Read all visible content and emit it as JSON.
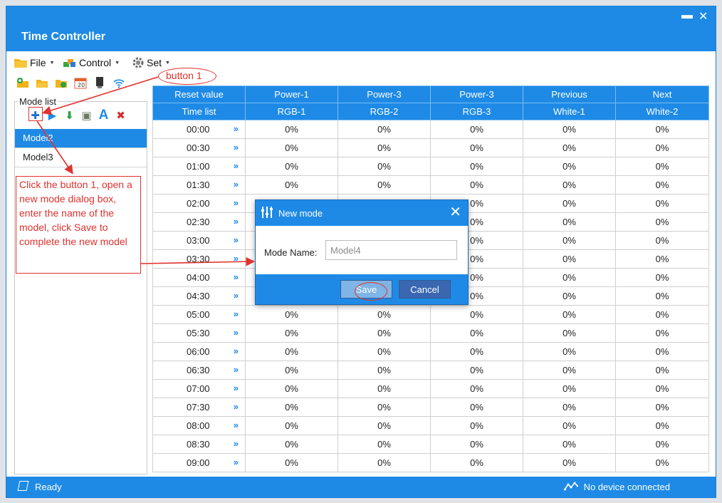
{
  "window": {
    "title": "Time Controller",
    "minimize_glyph": "▬",
    "close_glyph": "✕"
  },
  "menu": [
    {
      "label": "File",
      "icon": "folder-icon"
    },
    {
      "label": "Control",
      "icon": "blocks-icon"
    },
    {
      "label": "Set",
      "icon": "gear-icon"
    }
  ],
  "toolbar_icons": [
    "add-folder-icon",
    "open-folder-icon",
    "save-folder-icon",
    "calendar-icon",
    "device-icon",
    "wifi-icon"
  ],
  "mode_list": {
    "label": "Mode list",
    "tools": [
      {
        "name": "add-mode-icon",
        "glyph": "✚",
        "color": "#1e6fd0"
      },
      {
        "name": "play-icon",
        "glyph": "▶",
        "color": "#1e8ae6"
      },
      {
        "name": "download-icon",
        "glyph": "⬇",
        "color": "#2ea043"
      },
      {
        "name": "device-save-icon",
        "glyph": "▣",
        "color": "#6b7b5e"
      },
      {
        "name": "rename-icon",
        "glyph": "A",
        "color": "#1e8ae6"
      },
      {
        "name": "delete-icon",
        "glyph": "✖",
        "color": "#d32f2f"
      }
    ],
    "items": [
      {
        "label": "Model2",
        "selected": true
      },
      {
        "label": "Model3",
        "selected": false
      }
    ]
  },
  "grid": {
    "header_row1": [
      "Reset value",
      "Power-1",
      "Power-3",
      "Power-3",
      "Previous",
      "Next"
    ],
    "header_row2": [
      "Time list",
      "RGB-1",
      "RGB-2",
      "RGB-3",
      "White-1",
      "White-2"
    ],
    "chevron": "»",
    "rows": [
      {
        "time": "00:00",
        "values": [
          "0%",
          "0%",
          "0%",
          "0%",
          "0%"
        ]
      },
      {
        "time": "00:30",
        "values": [
          "0%",
          "0%",
          "0%",
          "0%",
          "0%"
        ]
      },
      {
        "time": "01:00",
        "values": [
          "0%",
          "0%",
          "0%",
          "0%",
          "0%"
        ]
      },
      {
        "time": "01:30",
        "values": [
          "0%",
          "0%",
          "0%",
          "0%",
          "0%"
        ]
      },
      {
        "time": "02:00",
        "values": [
          "",
          "",
          "0%",
          "0%",
          "0%"
        ]
      },
      {
        "time": "02:30",
        "values": [
          "",
          "",
          "0%",
          "0%",
          "0%"
        ]
      },
      {
        "time": "03:00",
        "values": [
          "",
          "",
          "0%",
          "0%",
          "0%"
        ]
      },
      {
        "time": "03:30",
        "values": [
          "",
          "",
          "0%",
          "0%",
          "0%"
        ]
      },
      {
        "time": "04:00",
        "values": [
          "",
          "",
          "0%",
          "0%",
          "0%"
        ]
      },
      {
        "time": "04:30",
        "values": [
          "",
          "",
          "0%",
          "0%",
          "0%"
        ]
      },
      {
        "time": "05:00",
        "values": [
          "0%",
          "0%",
          "0%",
          "0%",
          "0%"
        ]
      },
      {
        "time": "05:30",
        "values": [
          "0%",
          "0%",
          "0%",
          "0%",
          "0%"
        ]
      },
      {
        "time": "06:00",
        "values": [
          "0%",
          "0%",
          "0%",
          "0%",
          "0%"
        ]
      },
      {
        "time": "06:30",
        "values": [
          "0%",
          "0%",
          "0%",
          "0%",
          "0%"
        ]
      },
      {
        "time": "07:00",
        "values": [
          "0%",
          "0%",
          "0%",
          "0%",
          "0%"
        ]
      },
      {
        "time": "07:30",
        "values": [
          "0%",
          "0%",
          "0%",
          "0%",
          "0%"
        ]
      },
      {
        "time": "08:00",
        "values": [
          "0%",
          "0%",
          "0%",
          "0%",
          "0%"
        ]
      },
      {
        "time": "08:30",
        "values": [
          "0%",
          "0%",
          "0%",
          "0%",
          "0%"
        ]
      },
      {
        "time": "09:00",
        "values": [
          "0%",
          "0%",
          "0%",
          "0%",
          "0%"
        ]
      }
    ]
  },
  "status": {
    "ready": "Ready",
    "device": "No device connected"
  },
  "dialog": {
    "title": "New mode",
    "close_glyph": "✕",
    "field_label": "Mode Name:",
    "field_value": "Model4",
    "save_label": "Save",
    "cancel_label": "Cancel"
  },
  "annotations": {
    "button_label": "button 1",
    "instruction": "Click the button 1, open a new mode dialog box, enter the name of the model, click Save to complete the new model",
    "color": "#e0322f"
  },
  "colors": {
    "accent": "#1e8ae6",
    "selection": "#1e8ae6"
  }
}
